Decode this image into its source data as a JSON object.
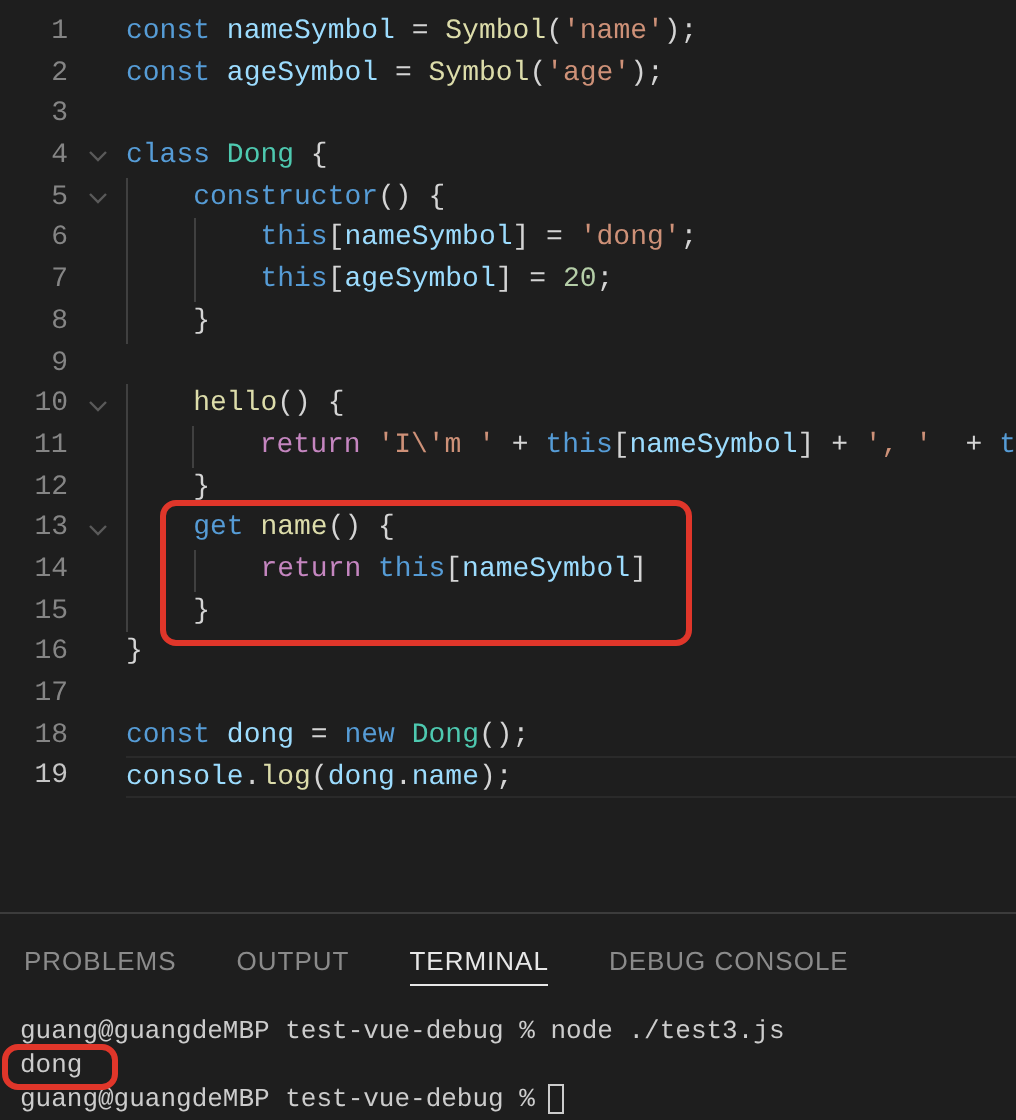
{
  "editor": {
    "lines": [
      {
        "number": "1",
        "tokens": [
          {
            "text": "const ",
            "kind": "kw"
          },
          {
            "text": "nameSymbol",
            "kind": "var"
          },
          {
            "text": " = ",
            "kind": "p"
          },
          {
            "text": "Symbol",
            "kind": "fn"
          },
          {
            "text": "(",
            "kind": "p"
          },
          {
            "text": "'name'",
            "kind": "str"
          },
          {
            "text": ");",
            "kind": "p"
          }
        ]
      },
      {
        "number": "2",
        "tokens": [
          {
            "text": "const ",
            "kind": "kw"
          },
          {
            "text": "ageSymbol",
            "kind": "var"
          },
          {
            "text": " = ",
            "kind": "p"
          },
          {
            "text": "Symbol",
            "kind": "fn"
          },
          {
            "text": "(",
            "kind": "p"
          },
          {
            "text": "'age'",
            "kind": "str"
          },
          {
            "text": ");",
            "kind": "p"
          }
        ]
      },
      {
        "number": "3"
      },
      {
        "number": "4",
        "foldable": true,
        "tokens": [
          {
            "text": "class ",
            "kind": "kw"
          },
          {
            "text": "Dong",
            "kind": "cls"
          },
          {
            "text": " {",
            "kind": "p"
          }
        ]
      },
      {
        "number": "5",
        "foldable": true,
        "tokens": [
          {
            "text": "    constructor",
            "kind": "kw"
          },
          {
            "text": "() {",
            "kind": "p"
          }
        ]
      },
      {
        "number": "6",
        "tokens": [
          {
            "text": "        this",
            "kind": "kw"
          },
          {
            "text": "[",
            "kind": "p"
          },
          {
            "text": "nameSymbol",
            "kind": "var"
          },
          {
            "text": "] = ",
            "kind": "p"
          },
          {
            "text": "'dong'",
            "kind": "str"
          },
          {
            "text": ";",
            "kind": "p"
          }
        ]
      },
      {
        "number": "7",
        "tokens": [
          {
            "text": "        this",
            "kind": "kw"
          },
          {
            "text": "[",
            "kind": "p"
          },
          {
            "text": "ageSymbol",
            "kind": "var"
          },
          {
            "text": "] = ",
            "kind": "p"
          },
          {
            "text": "20",
            "kind": "num"
          },
          {
            "text": ";",
            "kind": "p"
          }
        ]
      },
      {
        "number": "8",
        "tokens": [
          {
            "text": "    }",
            "kind": "p"
          }
        ]
      },
      {
        "number": "9"
      },
      {
        "number": "10",
        "foldable": true,
        "tokens": [
          {
            "text": "    hello",
            "kind": "fn"
          },
          {
            "text": "() {",
            "kind": "p"
          }
        ]
      },
      {
        "number": "11",
        "tokens": [
          {
            "text": "        return ",
            "kind": "ctl"
          },
          {
            "text": "'I\\'m '",
            "kind": "str"
          },
          {
            "text": " + ",
            "kind": "p"
          },
          {
            "text": "this",
            "kind": "kw"
          },
          {
            "text": "[",
            "kind": "p"
          },
          {
            "text": "nameSymbol",
            "kind": "var"
          },
          {
            "text": "] + ",
            "kind": "p"
          },
          {
            "text": "', '",
            "kind": "str"
          },
          {
            "text": "  + ",
            "kind": "p"
          },
          {
            "text": "t",
            "kind": "kw"
          }
        ]
      },
      {
        "number": "12",
        "tokens": [
          {
            "text": "    }",
            "kind": "p"
          }
        ]
      },
      {
        "number": "13",
        "foldable": true,
        "tokens": [
          {
            "text": "    get ",
            "kind": "kw"
          },
          {
            "text": "name",
            "kind": "fn"
          },
          {
            "text": "() {",
            "kind": "p"
          }
        ]
      },
      {
        "number": "14",
        "tokens": [
          {
            "text": "        return ",
            "kind": "ctl"
          },
          {
            "text": "this",
            "kind": "kw"
          },
          {
            "text": "[",
            "kind": "p"
          },
          {
            "text": "nameSymbol",
            "kind": "var"
          },
          {
            "text": "]",
            "kind": "p"
          }
        ]
      },
      {
        "number": "15",
        "tokens": [
          {
            "text": "    }",
            "kind": "p"
          }
        ]
      },
      {
        "number": "16",
        "tokens": [
          {
            "text": "}",
            "kind": "p"
          }
        ]
      },
      {
        "number": "17"
      },
      {
        "number": "18",
        "tokens": [
          {
            "text": "const ",
            "kind": "kw"
          },
          {
            "text": "dong",
            "kind": "var"
          },
          {
            "text": " = ",
            "kind": "p"
          },
          {
            "text": "new ",
            "kind": "kw"
          },
          {
            "text": "Dong",
            "kind": "cls"
          },
          {
            "text": "();",
            "kind": "p"
          }
        ]
      },
      {
        "number": "19",
        "current": true,
        "tokens": [
          {
            "text": "console",
            "kind": "var"
          },
          {
            "text": ".",
            "kind": "p"
          },
          {
            "text": "log",
            "kind": "fn"
          },
          {
            "text": "(",
            "kind": "p"
          },
          {
            "text": "dong",
            "kind": "var"
          },
          {
            "text": ".",
            "kind": "p"
          },
          {
            "text": "name",
            "kind": "var"
          },
          {
            "text": ");",
            "kind": "p"
          }
        ]
      }
    ]
  },
  "panel": {
    "tabs": [
      {
        "label": "PROBLEMS",
        "selected": false
      },
      {
        "label": "OUTPUT",
        "selected": false
      },
      {
        "label": "TERMINAL",
        "selected": true
      },
      {
        "label": "DEBUG CONSOLE",
        "selected": false
      }
    ],
    "terminal": {
      "lines": [
        "guang@guangdeMBP test-vue-debug % node ./test3.js",
        "dong",
        "guang@guangdeMBP test-vue-debug %"
      ],
      "cursor": true
    }
  }
}
